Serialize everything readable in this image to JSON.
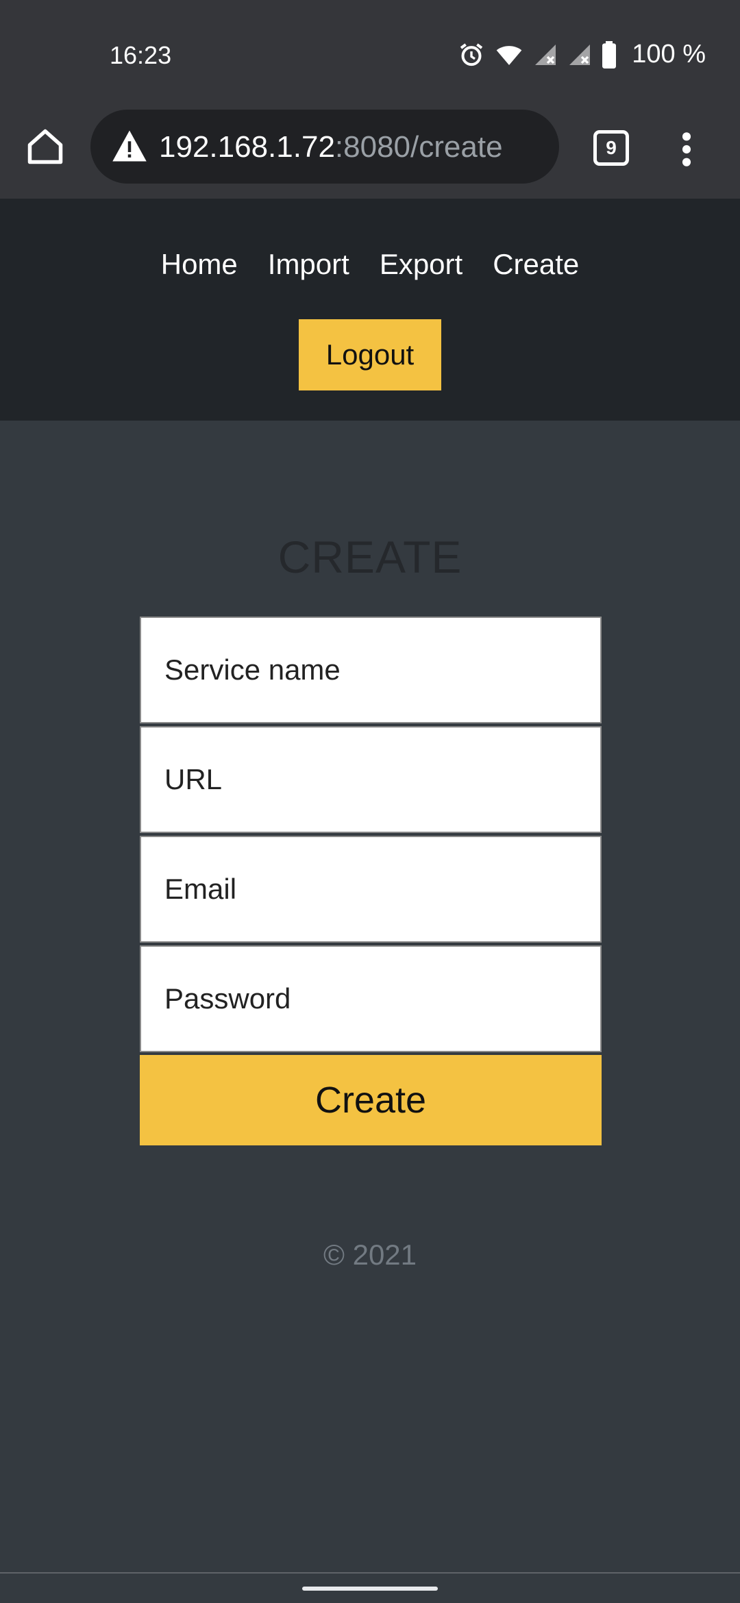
{
  "status_bar": {
    "time": "16:23",
    "battery_text": "100 %",
    "icons": [
      "alarm-icon",
      "wifi-icon",
      "signal-no-service-icon",
      "signal-no-service-icon",
      "battery-icon"
    ]
  },
  "browser": {
    "url_host": "192.168.1.72",
    "url_rest": ":8080/create",
    "tab_count": "9",
    "icons": [
      "home-icon",
      "not-secure-warning-icon",
      "tabs-switcher-icon",
      "more-vert-icon"
    ]
  },
  "nav": {
    "links": [
      "Home",
      "Import",
      "Export",
      "Create"
    ],
    "logout_label": "Logout",
    "colors": {
      "nav_bg": "#212529",
      "accent": "#f4c242"
    }
  },
  "main": {
    "title": "CREATE",
    "fields": {
      "service_name": {
        "placeholder": "Service name",
        "value": ""
      },
      "url": {
        "placeholder": "URL",
        "value": ""
      },
      "email": {
        "placeholder": "Email",
        "value": ""
      },
      "password": {
        "placeholder": "Password",
        "value": ""
      }
    },
    "submit_label": "Create"
  },
  "footer": {
    "text": "© 2021"
  }
}
